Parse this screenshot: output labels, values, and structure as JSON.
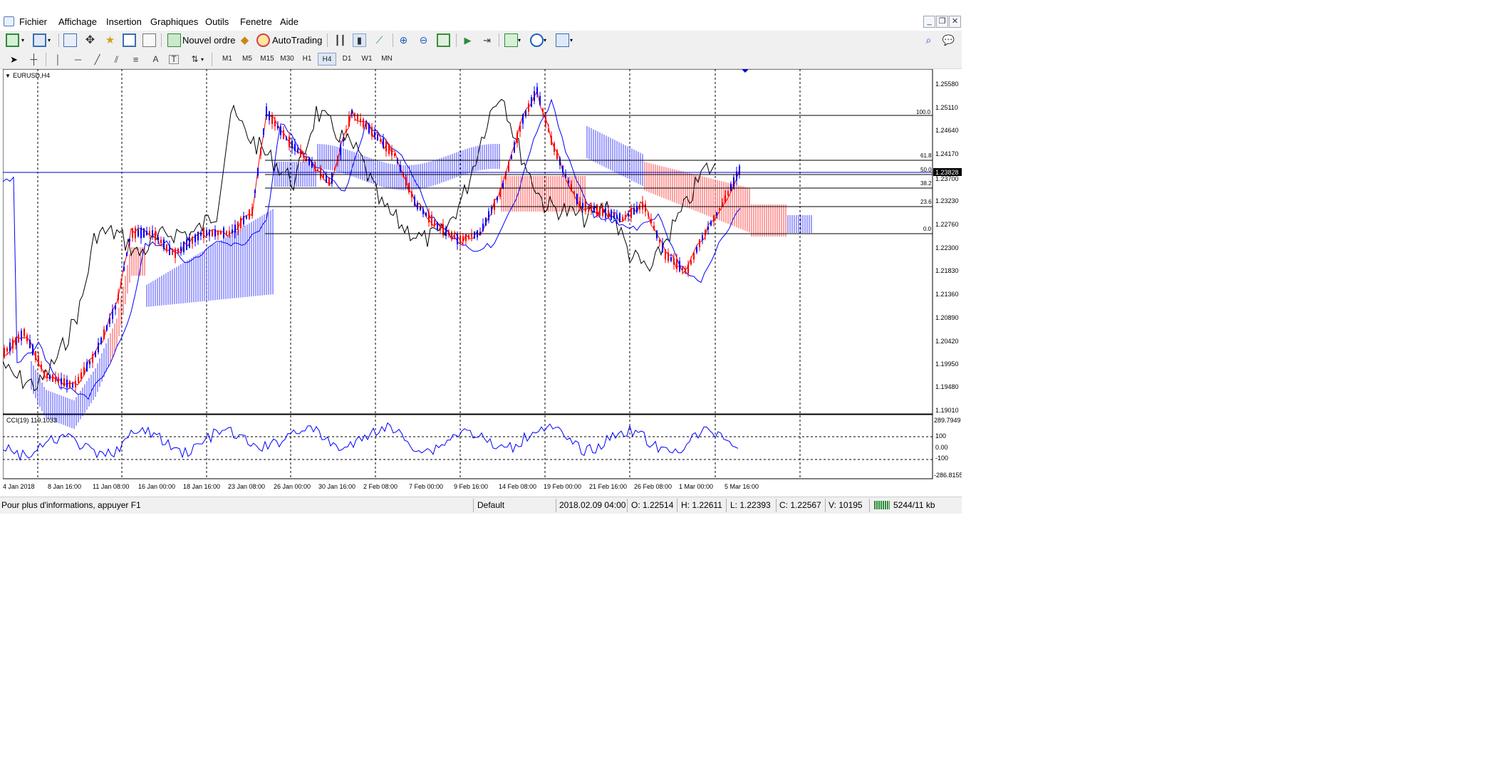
{
  "menu": {
    "items": [
      "Fichier",
      "Affichage",
      "Insertion",
      "Graphiques",
      "Outils",
      "Fenetre",
      "Aide"
    ]
  },
  "toolbar": {
    "new_order_label": "Nouvel ordre",
    "autotrading_label": "AutoTrading",
    "timeframes": [
      "M1",
      "M5",
      "M15",
      "M30",
      "H1",
      "H4",
      "D1",
      "W1",
      "MN"
    ],
    "active_timeframe": "H4"
  },
  "chart": {
    "symbol_label": "EURUSD,H4",
    "current_price_label": "1.23828",
    "price_axis_labels": [
      "1.25580",
      "1.25110",
      "1.24640",
      "1.24170",
      "1.23700",
      "1.23230",
      "1.22760",
      "1.22300",
      "1.21830",
      "1.21360",
      "1.20890",
      "1.20420",
      "1.19950",
      "1.19480",
      "1.19010"
    ],
    "fibo_levels": [
      "100.0",
      "61.8",
      "50.0",
      "38.2",
      "23.6",
      "0.0"
    ],
    "time_axis_labels": [
      "4 Jan 2018",
      "8 Jan 16:00",
      "11 Jan 08:00",
      "16 Jan 00:00",
      "18 Jan 16:00",
      "23 Jan 08:00",
      "26 Jan 00:00",
      "30 Jan 16:00",
      "2 Feb 08:00",
      "7 Feb 00:00",
      "9 Feb 16:00",
      "14 Feb 08:00",
      "19 Feb 00:00",
      "21 Feb 16:00",
      "26 Feb 08:00",
      "1 Mar 00:00",
      "5 Mar 16:00"
    ],
    "colors": {
      "bull": "#0000ff",
      "bear": "#ff0000",
      "chikou": "#000000",
      "grid": "#000000"
    }
  },
  "indicator": {
    "label": "CCI(19) 119.1033",
    "axis_labels": [
      "289.7949",
      "100",
      "0.00",
      "-100",
      "-286.8155"
    ]
  },
  "status": {
    "help": "Pour plus d'informations, appuyer F1",
    "profile": "Default",
    "datetime": "2018.02.09 04:00",
    "open": "O: 1.22514",
    "high": "H: 1.22611",
    "low": "L: 1.22393",
    "close": "C: 1.22567",
    "volume": "V: 10195",
    "traffic": "5244/11 kb"
  }
}
